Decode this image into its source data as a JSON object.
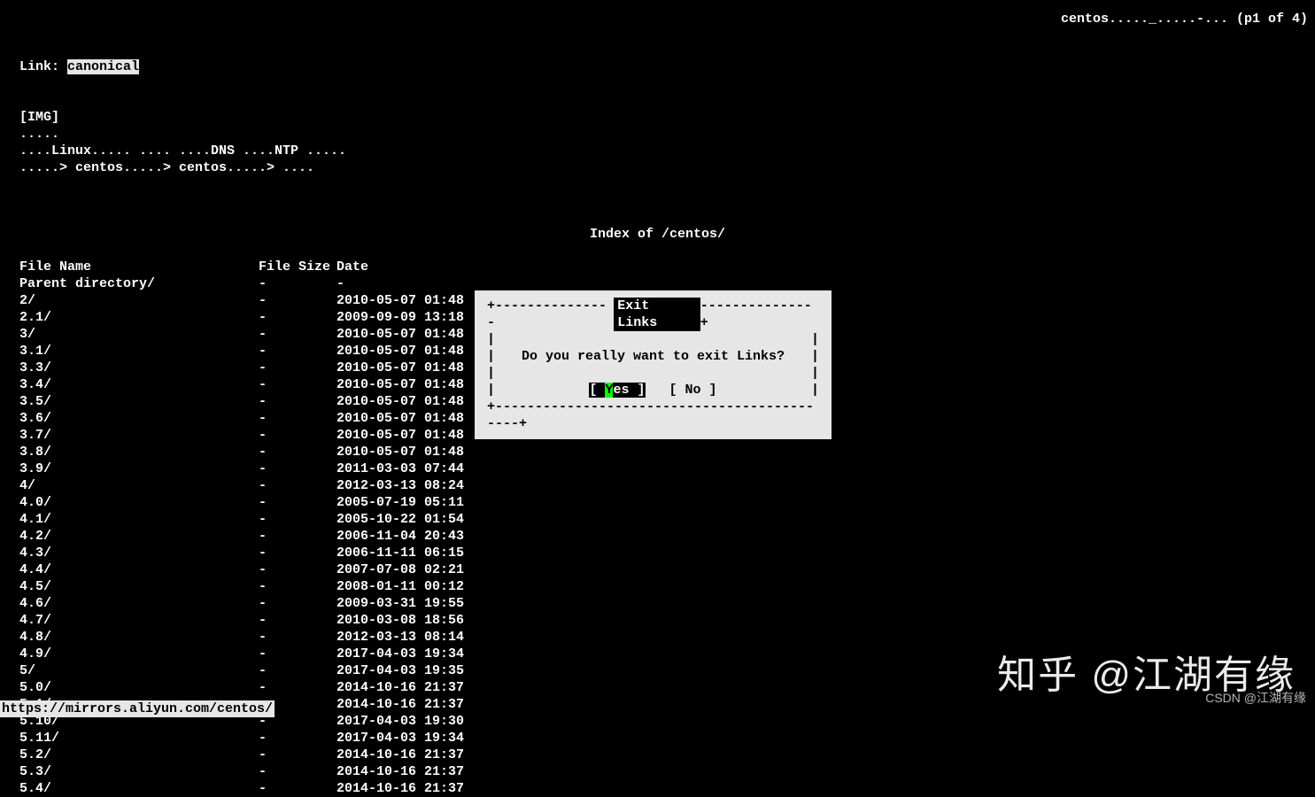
{
  "topright": "centos....._.....-... (p1 of 4)",
  "link_label": "Link: ",
  "selected_link": "canonical",
  "header_lines": [
    "[IMG]",
    ".....",
    "....Linux..... .... ....DNS ....NTP .....",
    ".....> centos.....> centos.....> ...."
  ],
  "page_title": "Index of /centos/",
  "table": {
    "headers": {
      "name": "File Name",
      "size": "File Size",
      "date": "Date"
    },
    "rows": [
      {
        "name": "Parent directory/",
        "size": "-",
        "date": "-"
      },
      {
        "name": "2/",
        "size": "-",
        "date": "2010-05-07 01:48"
      },
      {
        "name": "2.1/",
        "size": "-",
        "date": "2009-09-09 13:18"
      },
      {
        "name": "3/",
        "size": "-",
        "date": "2010-05-07 01:48"
      },
      {
        "name": "3.1/",
        "size": "-",
        "date": "2010-05-07 01:48"
      },
      {
        "name": "3.3/",
        "size": "-",
        "date": "2010-05-07 01:48"
      },
      {
        "name": "3.4/",
        "size": "-",
        "date": "2010-05-07 01:48"
      },
      {
        "name": "3.5/",
        "size": "-",
        "date": "2010-05-07 01:48"
      },
      {
        "name": "3.6/",
        "size": "-",
        "date": "2010-05-07 01:48"
      },
      {
        "name": "3.7/",
        "size": "-",
        "date": "2010-05-07 01:48"
      },
      {
        "name": "3.8/",
        "size": "-",
        "date": "2010-05-07 01:48"
      },
      {
        "name": "3.9/",
        "size": "-",
        "date": "2011-03-03 07:44"
      },
      {
        "name": "4/",
        "size": "-",
        "date": "2012-03-13 08:24"
      },
      {
        "name": "4.0/",
        "size": "-",
        "date": "2005-07-19 05:11"
      },
      {
        "name": "4.1/",
        "size": "-",
        "date": "2005-10-22 01:54"
      },
      {
        "name": "4.2/",
        "size": "-",
        "date": "2006-11-04 20:43"
      },
      {
        "name": "4.3/",
        "size": "-",
        "date": "2006-11-11 06:15"
      },
      {
        "name": "4.4/",
        "size": "-",
        "date": "2007-07-08 02:21"
      },
      {
        "name": "4.5/",
        "size": "-",
        "date": "2008-01-11 00:12"
      },
      {
        "name": "4.6/",
        "size": "-",
        "date": "2009-03-31 19:55"
      },
      {
        "name": "4.7/",
        "size": "-",
        "date": "2010-03-08 18:56"
      },
      {
        "name": "4.8/",
        "size": "-",
        "date": "2012-03-13 08:14"
      },
      {
        "name": "4.9/",
        "size": "-",
        "date": "2017-04-03 19:34"
      },
      {
        "name": "5/",
        "size": "-",
        "date": "2017-04-03 19:35"
      },
      {
        "name": "5.0/",
        "size": "-",
        "date": "2014-10-16 21:37"
      },
      {
        "name": "5.1/",
        "size": "-",
        "date": "2014-10-16 21:37"
      },
      {
        "name": "5.10/",
        "size": "-",
        "date": "2017-04-03 19:30"
      },
      {
        "name": "5.11/",
        "size": "-",
        "date": "2017-04-03 19:34"
      },
      {
        "name": "5.2/",
        "size": "-",
        "date": "2014-10-16 21:37"
      },
      {
        "name": "5.3/",
        "size": "-",
        "date": "2014-10-16 21:37"
      },
      {
        "name": "5.4/",
        "size": "-",
        "date": "2014-10-16 21:37"
      }
    ]
  },
  "dialog": {
    "title": " Exit Links ",
    "message": "Do you really want to exit Links?",
    "yes_hotkey": "Y",
    "yes_rest": "es",
    "no_label": "[ No ]",
    "border_top_left": "+---------------",
    "border_top_right": "--------------+",
    "border_side_l": "|",
    "border_side_r": "|",
    "border_bottom": "+--------------------------------------------+",
    "yes_open": "[ ",
    "yes_close": " ]"
  },
  "statusbar": "https://mirrors.aliyun.com/centos/",
  "watermark_big": "知乎 @江湖有缘",
  "watermark_small": "CSDN @江湖有缘"
}
